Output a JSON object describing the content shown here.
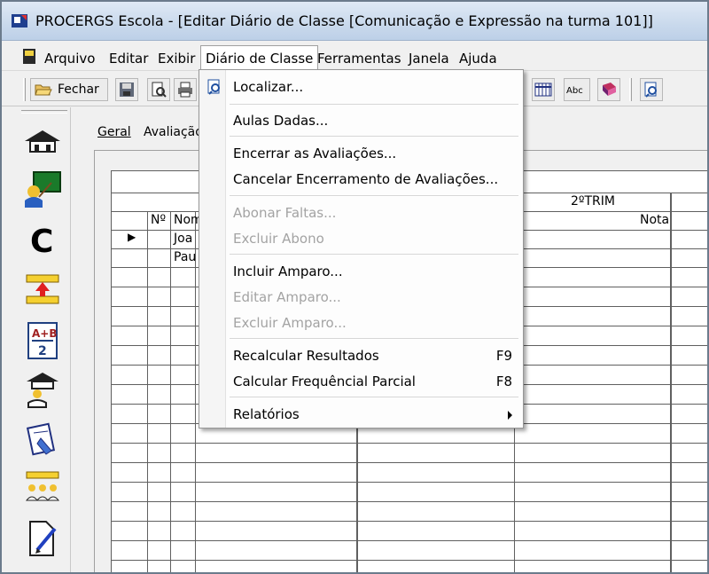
{
  "window": {
    "title": "PROCERGS Escola - [Editar Diário de Classe [Comunicação e Expressão na turma 101]]"
  },
  "menubar": {
    "items": [
      "Arquivo",
      "Editar",
      "Exibir",
      "Diário de Classe",
      "Ferramentas",
      "Janela",
      "Ajuda"
    ],
    "active": "Diário de Classe"
  },
  "toolbar": {
    "close_label": "Fechar",
    "icons": [
      "save-icon",
      "print-preview-icon",
      "print-icon",
      "grid-icon",
      "spell-check-icon",
      "book-icon",
      "search-icon"
    ]
  },
  "sidebar": {
    "icons": [
      "home-icon",
      "teacher-board-icon",
      "letter-c-icon",
      "hierarchy-icon",
      "grades-icon",
      "school-person-icon",
      "calendar-icon",
      "group-icon",
      "edit-document-icon"
    ]
  },
  "tabs": [
    "Geral",
    "Avaliação"
  ],
  "grid": {
    "columns": [
      "Nº",
      "Nome"
    ],
    "period_header": "2ºTRIM",
    "nota_header": "Nota",
    "rows": [
      {
        "name": "Joa"
      },
      {
        "name": "Pau"
      }
    ]
  },
  "dropdown": {
    "items": [
      {
        "label": "Localizar...",
        "shortcut": "",
        "enabled": true,
        "icon": "search-icon"
      },
      {
        "label": "Aulas Dadas...",
        "shortcut": "",
        "enabled": true
      },
      {
        "label": "Encerrar as Avaliações...",
        "shortcut": "",
        "enabled": true
      },
      {
        "label": "Cancelar Encerramento de Avaliações...",
        "shortcut": "",
        "enabled": true
      },
      {
        "label": "Abonar Faltas...",
        "shortcut": "",
        "enabled": false
      },
      {
        "label": "Excluir Abono",
        "shortcut": "",
        "enabled": false
      },
      {
        "label": "Incluir Amparo...",
        "shortcut": "",
        "enabled": true
      },
      {
        "label": "Editar Amparo...",
        "shortcut": "",
        "enabled": false
      },
      {
        "label": "Excluir Amparo...",
        "shortcut": "",
        "enabled": false
      },
      {
        "label": "Recalcular Resultados",
        "shortcut": "F9",
        "enabled": true
      },
      {
        "label": "Calcular Frequêncial Parcial",
        "shortcut": "F8",
        "enabled": true
      },
      {
        "label": "Relatórios",
        "shortcut": "",
        "enabled": true,
        "submenu": true
      }
    ]
  }
}
